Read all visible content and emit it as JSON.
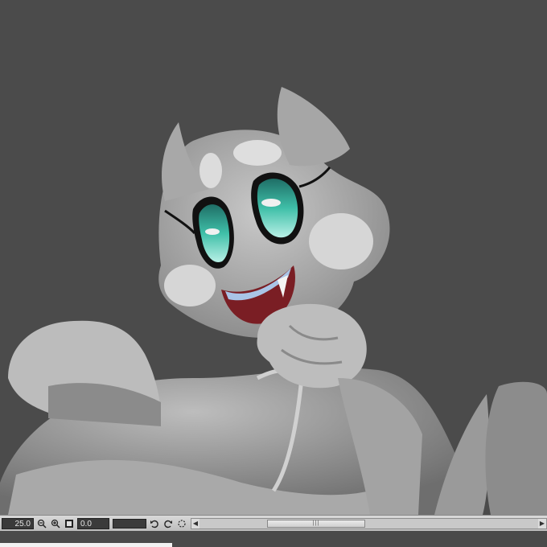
{
  "canvas": {
    "background": "#4b4b4b",
    "artwork": "grayscale cartoon character illustration with teal eyes"
  },
  "statusbar": {
    "zoom_value": "25.0",
    "rotation_value": "0.0",
    "scroll_grip": "|||"
  },
  "colors": {
    "eye_teal": "#3fbfa8",
    "mouth_red": "#7a1e24",
    "tongue_blue": "#a9c4e6"
  }
}
